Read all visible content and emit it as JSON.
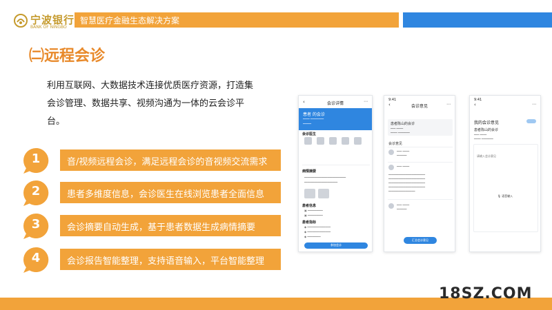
{
  "colors": {
    "accent": "#f2a33a",
    "title": "#e8892a",
    "brand_gold": "#c59a2c",
    "blue": "#2f86e0"
  },
  "header": {
    "logo_cn": "宁波银行",
    "logo_en": "BANK OF NINGBO",
    "title": "智慧医疗金融生态解决方案"
  },
  "section": {
    "title": "㈡远程会诊",
    "intro": "利用互联网、大数据技术连接优质医疗资源，打造集会诊管理、数据共享、视频沟通为一体的云会诊平台。"
  },
  "features": [
    {
      "num": "1",
      "text": "音/视频远程会诊，满足远程会诊的音视频交流需求"
    },
    {
      "num": "2",
      "text": "患者多维度信息，会诊医生在线浏览患者全面信息"
    },
    {
      "num": "3",
      "text": "会诊摘要自动生成，基于患者数据生成病情摘要"
    },
    {
      "num": "4",
      "text": "会诊报告智能整理，支持语音输入，平台智能整理"
    }
  ],
  "phone1": {
    "nav_title": "会诊详情",
    "head_title": "患者 的会诊",
    "section_doctors": "会诊医生",
    "section_summary": "病情摘要",
    "section_info": "患者信息",
    "section_metrics": "患者指标",
    "button": "参加会诊"
  },
  "phone2": {
    "status_time": "9:41",
    "nav_title": "会诊意见",
    "card_title": "患者陈山的会诊",
    "section_opinion": "会诊意见",
    "button": "汇总会诊意见"
  },
  "phone3": {
    "status_time": "9:41",
    "nav_title": "",
    "title": "我的会诊意见",
    "card_title": "患者陈山的会诊",
    "placeholder": "请输入会诊意见",
    "voice": "语音输入"
  },
  "watermark": "18SZ.COM"
}
